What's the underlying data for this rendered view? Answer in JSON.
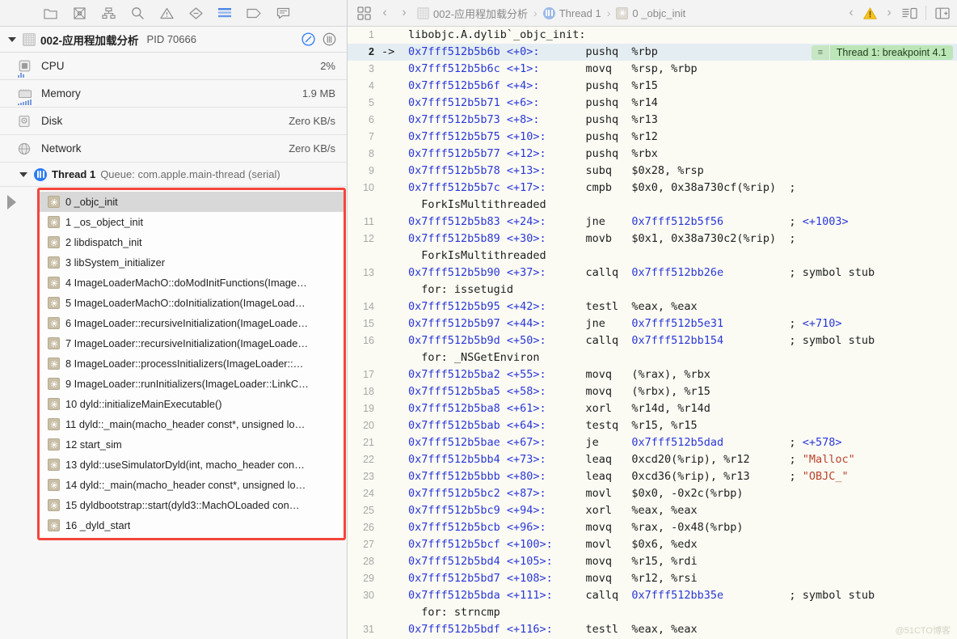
{
  "left_panel": {
    "toolbar": {
      "icons": [
        {
          "name": "folder-icon",
          "label": "Project navigator"
        },
        {
          "name": "source-control-icon",
          "label": "Source control navigator"
        },
        {
          "name": "symbol-hierarchy-icon",
          "label": "Symbol navigator"
        },
        {
          "name": "search-icon",
          "label": "Find navigator"
        },
        {
          "name": "warning-triangle-icon",
          "label": "Issue navigator"
        },
        {
          "name": "test-diamond-icon",
          "label": "Test navigator"
        },
        {
          "name": "debug-list-icon",
          "label": "Debug navigator"
        },
        {
          "name": "breakpoint-tag-icon",
          "label": "Breakpoint navigator"
        },
        {
          "name": "report-bubble-icon",
          "label": "Report navigator"
        }
      ],
      "active_index": 6
    },
    "process": {
      "title": "002-应用程加载分析",
      "pid_label": "PID 70666",
      "gauge_icon": "gauge-icon",
      "thread_icon": "pause-columns-icon"
    },
    "resources": [
      {
        "icon": "cpu-icon",
        "label": "CPU",
        "value": "2%",
        "spark": [
          2,
          4,
          3
        ]
      },
      {
        "icon": "memory-icon",
        "label": "Memory",
        "value": "1.9 MB",
        "spark": [
          2,
          3,
          4,
          5,
          6,
          7
        ]
      },
      {
        "icon": "disk-icon",
        "label": "Disk",
        "value": "Zero KB/s",
        "spark": []
      },
      {
        "icon": "network-icon",
        "label": "Network",
        "value": "Zero KB/s",
        "spark": []
      }
    ],
    "thread": {
      "name": "Thread 1",
      "queue": "Queue: com.apple.main-thread (serial)"
    },
    "frames": [
      {
        "index": "0",
        "symbol": "_objc_init",
        "selected": true
      },
      {
        "index": "1",
        "symbol": "_os_object_init",
        "selected": false
      },
      {
        "index": "2",
        "symbol": "libdispatch_init",
        "selected": false
      },
      {
        "index": "3",
        "symbol": "libSystem_initializer",
        "selected": false
      },
      {
        "index": "4",
        "symbol": "ImageLoaderMachO::doModInitFunctions(Image…",
        "selected": false
      },
      {
        "index": "5",
        "symbol": "ImageLoaderMachO::doInitialization(ImageLoad…",
        "selected": false
      },
      {
        "index": "6",
        "symbol": "ImageLoader::recursiveInitialization(ImageLoade…",
        "selected": false
      },
      {
        "index": "7",
        "symbol": "ImageLoader::recursiveInitialization(ImageLoade…",
        "selected": false
      },
      {
        "index": "8",
        "symbol": "ImageLoader::processInitializers(ImageLoader::…",
        "selected": false
      },
      {
        "index": "9",
        "symbol": "ImageLoader::runInitializers(ImageLoader::LinkC…",
        "selected": false
      },
      {
        "index": "10",
        "symbol": "dyld::initializeMainExecutable()",
        "selected": false
      },
      {
        "index": "11",
        "symbol": "dyld::_main(macho_header const*, unsigned lo…",
        "selected": false
      },
      {
        "index": "12",
        "symbol": "start_sim",
        "selected": false
      },
      {
        "index": "13",
        "symbol": "dyld::useSimulatorDyld(int, macho_header con…",
        "selected": false
      },
      {
        "index": "14",
        "symbol": "dyld::_main(macho_header const*, unsigned lo…",
        "selected": false
      },
      {
        "index": "15",
        "symbol": "dyldbootstrap::start(dyld3::MachOLoaded con…",
        "selected": false
      },
      {
        "index": "16",
        "symbol": "_dyld_start",
        "selected": false
      }
    ],
    "highlight_color": "#f4453c"
  },
  "right_panel": {
    "jump_bar": {
      "related_items_icon": "related-items-icon",
      "back_label": "‹",
      "forward_label": "›",
      "breadcrumb": [
        {
          "icon": "process-icon",
          "label": "002-应用程加载分析"
        },
        {
          "icon": "thread-icon",
          "label": "Thread 1"
        },
        {
          "icon": "frame-gear-icon",
          "label": "0 _objc_init"
        }
      ],
      "prev_issue_label": "‹",
      "warning_icon": "warning-triangle-icon",
      "next_issue_label": "›",
      "assistant_editor_icon": "assistant-editor-icon",
      "add-editor_icon": "add-editor-icon"
    },
    "breakpoint_annotation": {
      "handle_icon": "drag-handle-icon",
      "text": "Thread 1: breakpoint 4.1",
      "bg_color": "#bce6b7"
    },
    "watermark": "@51CTO博客",
    "code": [
      {
        "num": "1",
        "arrow": "",
        "current": false,
        "addr": "",
        "offset": "",
        "mnemonic": "",
        "operands": "",
        "comment": "",
        "raw": "libobjc.A.dylib`_objc_init:",
        "cont": ""
      },
      {
        "num": "2",
        "arrow": "->",
        "current": true,
        "addr": "0x7fff512b5b6b",
        "offset": "<+0>:",
        "mnemonic": "pushq",
        "operands": "%rbp",
        "comment": "",
        "cont": ""
      },
      {
        "num": "3",
        "arrow": "",
        "current": false,
        "addr": "0x7fff512b5b6c",
        "offset": "<+1>:",
        "mnemonic": "movq",
        "operands": "%rsp, %rbp",
        "comment": "",
        "cont": ""
      },
      {
        "num": "4",
        "arrow": "",
        "current": false,
        "addr": "0x7fff512b5b6f",
        "offset": "<+4>:",
        "mnemonic": "pushq",
        "operands": "%r15",
        "comment": "",
        "cont": ""
      },
      {
        "num": "5",
        "arrow": "",
        "current": false,
        "addr": "0x7fff512b5b71",
        "offset": "<+6>:",
        "mnemonic": "pushq",
        "operands": "%r14",
        "comment": "",
        "cont": ""
      },
      {
        "num": "6",
        "arrow": "",
        "current": false,
        "addr": "0x7fff512b5b73",
        "offset": "<+8>:",
        "mnemonic": "pushq",
        "operands": "%r13",
        "comment": "",
        "cont": ""
      },
      {
        "num": "7",
        "arrow": "",
        "current": false,
        "addr": "0x7fff512b5b75",
        "offset": "<+10>:",
        "mnemonic": "pushq",
        "operands": "%r12",
        "comment": "",
        "cont": ""
      },
      {
        "num": "8",
        "arrow": "",
        "current": false,
        "addr": "0x7fff512b5b77",
        "offset": "<+12>:",
        "mnemonic": "pushq",
        "operands": "%rbx",
        "comment": "",
        "cont": ""
      },
      {
        "num": "9",
        "arrow": "",
        "current": false,
        "addr": "0x7fff512b5b78",
        "offset": "<+13>:",
        "mnemonic": "subq",
        "operands": "$0x28, %rsp",
        "comment": "",
        "cont": ""
      },
      {
        "num": "10",
        "arrow": "",
        "current": false,
        "addr": "0x7fff512b5b7c",
        "offset": "<+17>:",
        "mnemonic": "cmpb",
        "operands": "$0x0, 0x38a730cf(%rip)",
        "comment": ";",
        "cont": "ForkIsMultithreaded"
      },
      {
        "num": "11",
        "arrow": "",
        "current": false,
        "addr": "0x7fff512b5b83",
        "offset": "<+24>:",
        "mnemonic": "jne",
        "operands": "0x7fff512b5f56",
        "operands_link": true,
        "comment": "; <+1003>",
        "cont": ""
      },
      {
        "num": "12",
        "arrow": "",
        "current": false,
        "addr": "0x7fff512b5b89",
        "offset": "<+30>:",
        "mnemonic": "movb",
        "operands": "$0x1, 0x38a730c2(%rip)",
        "comment": ";",
        "cont": "ForkIsMultithreaded"
      },
      {
        "num": "13",
        "arrow": "",
        "current": false,
        "addr": "0x7fff512b5b90",
        "offset": "<+37>:",
        "mnemonic": "callq",
        "operands": "0x7fff512bb26e",
        "operands_link": true,
        "comment": "; symbol stub",
        "cont": "for: issetugid"
      },
      {
        "num": "14",
        "arrow": "",
        "current": false,
        "addr": "0x7fff512b5b95",
        "offset": "<+42>:",
        "mnemonic": "testl",
        "operands": "%eax, %eax",
        "comment": "",
        "cont": ""
      },
      {
        "num": "15",
        "arrow": "",
        "current": false,
        "addr": "0x7fff512b5b97",
        "offset": "<+44>:",
        "mnemonic": "jne",
        "operands": "0x7fff512b5e31",
        "operands_link": true,
        "comment": "; <+710>",
        "cont": ""
      },
      {
        "num": "16",
        "arrow": "",
        "current": false,
        "addr": "0x7fff512b5b9d",
        "offset": "<+50>:",
        "mnemonic": "callq",
        "operands": "0x7fff512bb154",
        "operands_link": true,
        "comment": "; symbol stub",
        "cont": "for: _NSGetEnviron"
      },
      {
        "num": "17",
        "arrow": "",
        "current": false,
        "addr": "0x7fff512b5ba2",
        "offset": "<+55>:",
        "mnemonic": "movq",
        "operands": "(%rax), %rbx",
        "comment": "",
        "cont": ""
      },
      {
        "num": "18",
        "arrow": "",
        "current": false,
        "addr": "0x7fff512b5ba5",
        "offset": "<+58>:",
        "mnemonic": "movq",
        "operands": "(%rbx), %r15",
        "comment": "",
        "cont": ""
      },
      {
        "num": "19",
        "arrow": "",
        "current": false,
        "addr": "0x7fff512b5ba8",
        "offset": "<+61>:",
        "mnemonic": "xorl",
        "operands": "%r14d, %r14d",
        "comment": "",
        "cont": ""
      },
      {
        "num": "20",
        "arrow": "",
        "current": false,
        "addr": "0x7fff512b5bab",
        "offset": "<+64>:",
        "mnemonic": "testq",
        "operands": "%r15, %r15",
        "comment": "",
        "cont": ""
      },
      {
        "num": "21",
        "arrow": "",
        "current": false,
        "addr": "0x7fff512b5bae",
        "offset": "<+67>:",
        "mnemonic": "je",
        "operands": "0x7fff512b5dad",
        "operands_link": true,
        "comment": "; <+578>",
        "cont": ""
      },
      {
        "num": "22",
        "arrow": "",
        "current": false,
        "addr": "0x7fff512b5bb4",
        "offset": "<+73>:",
        "mnemonic": "leaq",
        "operands": "0xcd20(%rip), %r12",
        "comment": "; \"Malloc\"",
        "comment_str": true,
        "cont": ""
      },
      {
        "num": "23",
        "arrow": "",
        "current": false,
        "addr": "0x7fff512b5bbb",
        "offset": "<+80>:",
        "mnemonic": "leaq",
        "operands": "0xcd36(%rip), %r13",
        "comment": "; \"OBJC_\"",
        "comment_str": true,
        "cont": ""
      },
      {
        "num": "24",
        "arrow": "",
        "current": false,
        "addr": "0x7fff512b5bc2",
        "offset": "<+87>:",
        "mnemonic": "movl",
        "operands": "$0x0, -0x2c(%rbp)",
        "comment": "",
        "cont": ""
      },
      {
        "num": "25",
        "arrow": "",
        "current": false,
        "addr": "0x7fff512b5bc9",
        "offset": "<+94>:",
        "mnemonic": "xorl",
        "operands": "%eax, %eax",
        "comment": "",
        "cont": ""
      },
      {
        "num": "26",
        "arrow": "",
        "current": false,
        "addr": "0x7fff512b5bcb",
        "offset": "<+96>:",
        "mnemonic": "movq",
        "operands": "%rax, -0x48(%rbp)",
        "comment": "",
        "cont": ""
      },
      {
        "num": "27",
        "arrow": "",
        "current": false,
        "addr": "0x7fff512b5bcf",
        "offset": "<+100>:",
        "mnemonic": "movl",
        "operands": "$0x6, %edx",
        "comment": "",
        "cont": ""
      },
      {
        "num": "28",
        "arrow": "",
        "current": false,
        "addr": "0x7fff512b5bd4",
        "offset": "<+105>:",
        "mnemonic": "movq",
        "operands": "%r15, %rdi",
        "comment": "",
        "cont": ""
      },
      {
        "num": "29",
        "arrow": "",
        "current": false,
        "addr": "0x7fff512b5bd7",
        "offset": "<+108>:",
        "mnemonic": "movq",
        "operands": "%r12, %rsi",
        "comment": "",
        "cont": ""
      },
      {
        "num": "30",
        "arrow": "",
        "current": false,
        "addr": "0x7fff512b5bda",
        "offset": "<+111>:",
        "mnemonic": "callq",
        "operands": "0x7fff512bb35e",
        "operands_link": true,
        "comment": "; symbol stub",
        "cont": "for: strncmp"
      },
      {
        "num": "31",
        "arrow": "",
        "current": false,
        "addr": "0x7fff512b5bdf",
        "offset": "<+116>:",
        "mnemonic": "testl",
        "operands": "%eax, %eax",
        "comment": "",
        "cont": ""
      }
    ]
  }
}
